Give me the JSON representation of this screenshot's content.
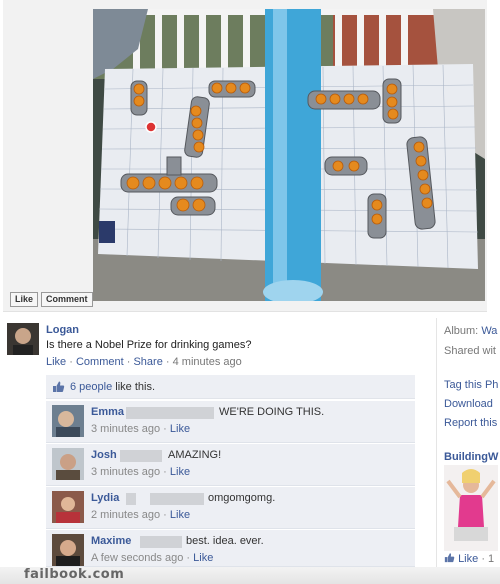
{
  "photo": {
    "like_label": "Like",
    "comment_label": "Comment"
  },
  "post": {
    "author": "Logan",
    "text": "Is there a Nobel Prize for drinking games?",
    "actions": {
      "like": "Like",
      "comment": "Comment",
      "share": "Share",
      "time": "4 minutes ago",
      "sep": "·"
    },
    "likes_text": "6 people",
    "likes_suffix": "like this."
  },
  "comments": [
    {
      "name": "Emma",
      "text": "WE'RE DOING THIS.",
      "time": "3 minutes ago",
      "like": "Like"
    },
    {
      "name": "Josh",
      "text": "AMAZING!",
      "time": "3 minutes ago",
      "like": "Like"
    },
    {
      "name": "Lydia",
      "text": "omgomgomg.",
      "time": "2 minutes ago",
      "like": "Like"
    },
    {
      "name": "Maxime",
      "text": "best. idea. ever.",
      "time": "A few seconds ago",
      "like": "Like"
    }
  ],
  "sidebar": {
    "album_label": "Album:",
    "album_value": "Wa",
    "shared": "Shared wit",
    "tag": "Tag this Ph",
    "download": "Download",
    "report": "Report this",
    "ad_title": "BuildingW",
    "ad_like": "Like",
    "ad_count": "· 1"
  },
  "watermark": "failbook.com",
  "colors": {
    "link": "#3b5998",
    "comment_bg": "#edeff4"
  }
}
